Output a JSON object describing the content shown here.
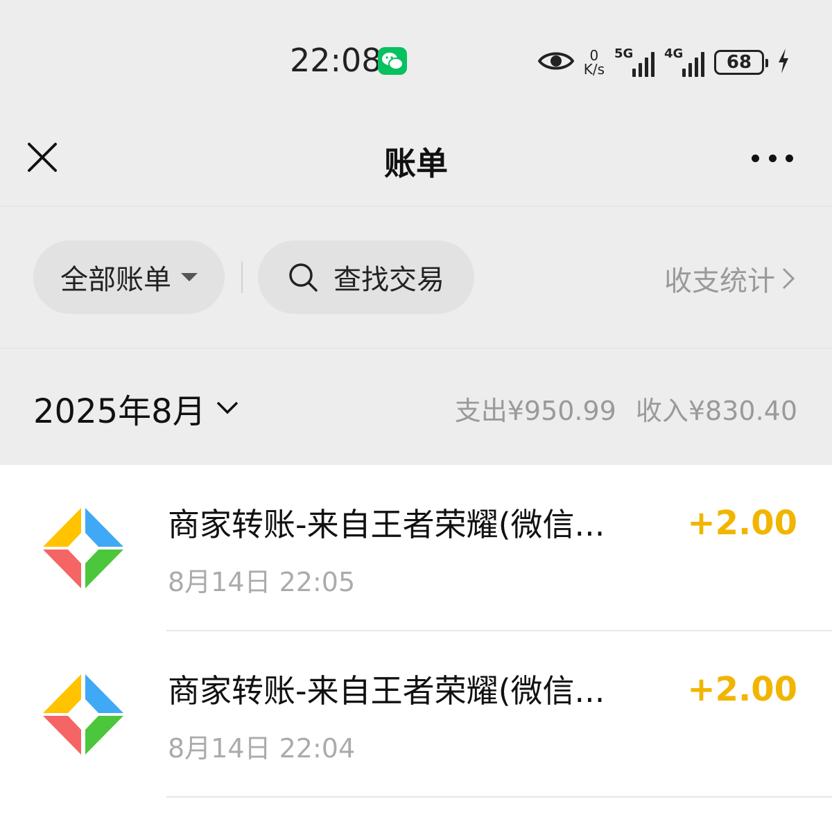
{
  "status_bar": {
    "time": "22:08",
    "net_speed_value": "0",
    "net_speed_unit": "K/s",
    "sim1_label": "5G",
    "sim2_label": "4G",
    "battery": "68",
    "notification_icon": "wechat-icon"
  },
  "nav": {
    "title": "账单"
  },
  "filters": {
    "all_bills_label": "全部账单",
    "search_label": "查找交易",
    "stats_label": "收支统计"
  },
  "month": {
    "label": "2025年8月",
    "expense": "支出¥950.99",
    "income": "收入¥830.40"
  },
  "transactions": [
    {
      "title": "商家转账-来自王者荣耀(微信...",
      "time": "8月14日 22:05",
      "amount": "+2.00"
    },
    {
      "title": "商家转账-来自王者荣耀(微信...",
      "time": "8月14日 22:04",
      "amount": "+2.00"
    }
  ],
  "colors": {
    "income_amount": "#f1b500",
    "wechat_green": "#07c160",
    "logo_yellow": "#ffc300",
    "logo_blue": "#3fa9f5",
    "logo_red": "#f56565",
    "logo_green": "#4cc63a"
  }
}
